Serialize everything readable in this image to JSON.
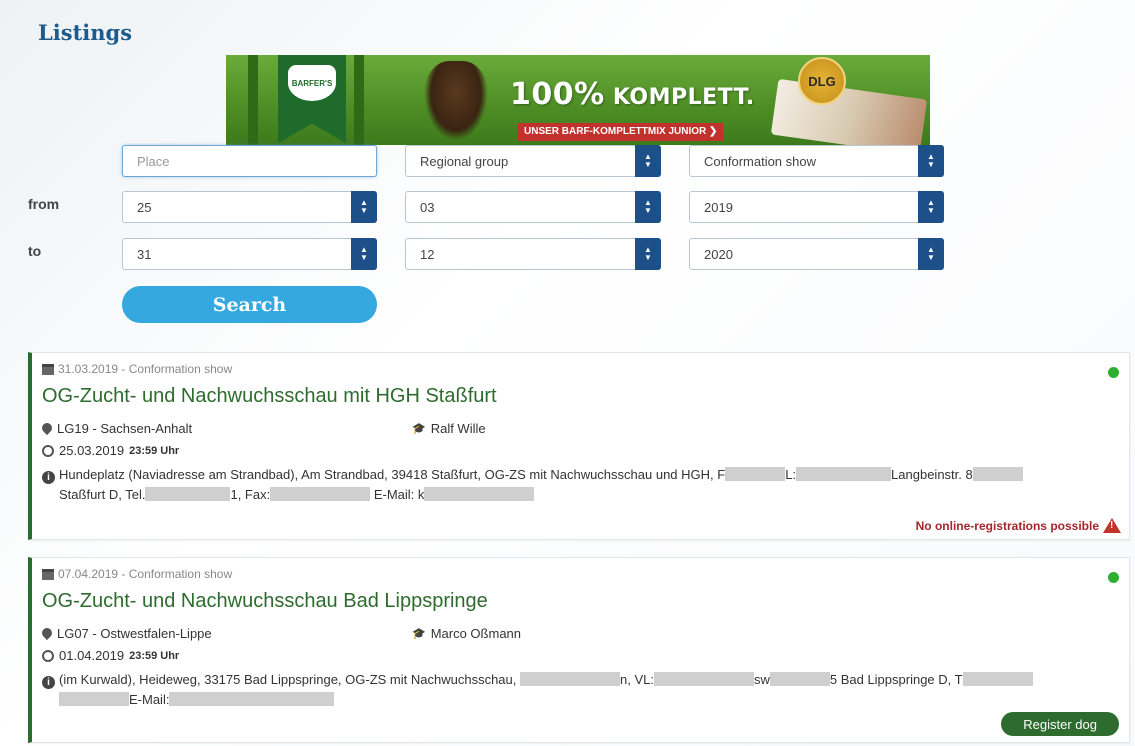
{
  "page": {
    "title": "Listings"
  },
  "banner": {
    "brand": "BARFER'S",
    "headline_main": "100%",
    "headline_rest": " KOMPLETT.",
    "tagline": "UNSER BARF-KOMPLETTMIX JUNIOR ❯",
    "seal": "DLG"
  },
  "filters": {
    "place_placeholder": "Place",
    "regional_group": "Regional group",
    "show_type": "Conformation show",
    "from_label": "from",
    "to_label": "to",
    "from": {
      "day": "25",
      "month": "03",
      "year": "2019"
    },
    "to": {
      "day": "31",
      "month": "12",
      "year": "2020"
    },
    "search_label": "Search"
  },
  "listings": [
    {
      "meta": "31.03.2019 - Conformation show",
      "title": "OG-Zucht- und Nachwuchsschau mit HGH Staßfurt",
      "region": "LG19 - Sachsen-Anhalt",
      "judge": "Ralf Wille",
      "deadline_date": "25.03.2019",
      "deadline_time": "23:59 Uhr",
      "info_a": "Hundeplatz (Naviadresse am Strandbad), Am Strandbad, 39418 Staßfurt, OG-ZS mit Nachwuchsschau und HGH, F",
      "info_b": "L:",
      "info_c": "Langbeinstr. 8",
      "info_d": "Staßfurt D, Tel.",
      "info_e": "1, Fax:",
      "info_f": "E-Mail: k",
      "status": "No online-registrations possible"
    },
    {
      "meta": "07.04.2019 - Conformation show",
      "title": "OG-Zucht- und Nachwuchsschau Bad Lippspringe",
      "region": "LG07 - Ostwestfalen-Lippe",
      "judge": "Marco Oßmann",
      "deadline_date": "01.04.2019",
      "deadline_time": "23:59 Uhr",
      "info_a": "(im Kurwald), Heideweg, 33175 Bad Lippspringe, OG-ZS mit Nachwuchsschau,",
      "info_b": "n, VL:",
      "info_c": "sw",
      "info_d": "5 Bad Lippspringe D, T",
      "info_e": "E-Mail:",
      "action": "Register dog"
    }
  ]
}
